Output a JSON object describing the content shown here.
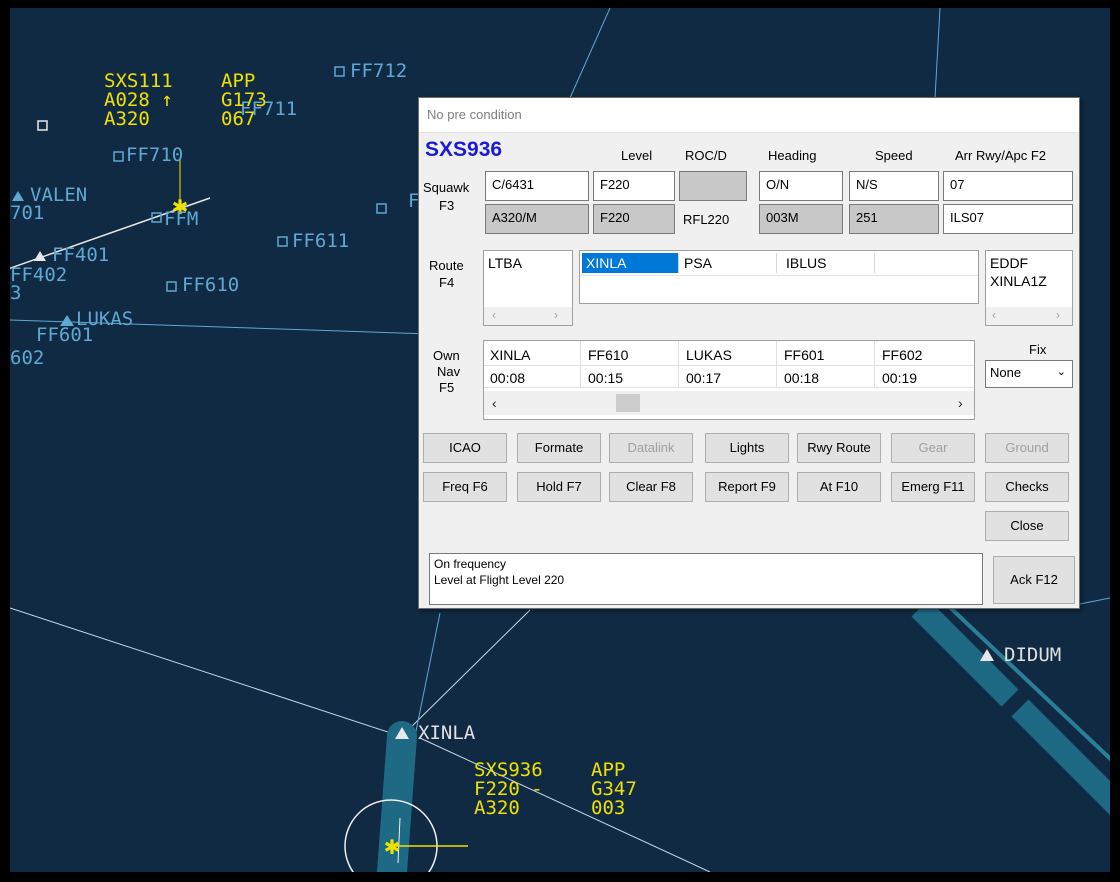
{
  "radar": {
    "fixes": [
      "FF712",
      "FF711",
      "FF710",
      "FFM",
      "FF611",
      "FF610",
      "FF401",
      "FF402",
      "FF601",
      "LUKAS",
      "VALEN",
      "XINLA",
      "DIDUM",
      "701",
      "602",
      "F",
      "3"
    ],
    "tags": [
      {
        "callsign": "SXS111",
        "stage": "APP",
        "level": "A028 ↑",
        "ground": "G173",
        "type": "A320",
        "speed": "067"
      },
      {
        "callsign": "SXS936",
        "stage": "APP",
        "level": "F220 -",
        "ground": "G347",
        "type": "A320",
        "speed": "003"
      }
    ],
    "colors": {
      "background": "#0f2a42",
      "fix": "#5fa8d3",
      "tag": "#f0e000",
      "route": "#1e6a84"
    }
  },
  "dialog": {
    "title": "No pre condition",
    "callsign": "SXS936",
    "headers": {
      "level": "Level",
      "rocd": "ROC/D",
      "heading": "Heading",
      "speed": "Speed",
      "arr": "Arr Rwy/Apc F2"
    },
    "squawk_label": "Squawk",
    "f3_label": "F3",
    "row1": {
      "squawk": "C/6431",
      "level": "F220",
      "rocd": "",
      "heading": "O/N",
      "speed": "N/S",
      "arr": "07"
    },
    "row2": {
      "type": "A320/M",
      "level": "F220",
      "rfl": "RFL220",
      "heading": "003M",
      "speed": "251",
      "app": "ILS07"
    },
    "route_label": "Route",
    "f4_label": "F4",
    "origin": "LTBA",
    "route_points": [
      "XINLA",
      "PSA",
      "IBLUS"
    ],
    "dest": {
      "airport": "EDDF",
      "star": "XINLA1Z"
    },
    "own_label": "Own",
    "nav_label": "Nav",
    "f5_label": "F5",
    "nav_points": [
      {
        "fix": "XINLA",
        "time": "00:08"
      },
      {
        "fix": "FF610",
        "time": "00:15"
      },
      {
        "fix": "LUKAS",
        "time": "00:17"
      },
      {
        "fix": "FF601",
        "time": "00:18"
      },
      {
        "fix": "FF602",
        "time": "00:19"
      }
    ],
    "fix_label": "Fix",
    "fix_value": "None",
    "buttons_row1": [
      "ICAO",
      "Formate",
      "Datalink",
      "Lights",
      "Rwy Route",
      "Gear",
      "Ground"
    ],
    "buttons_row2": [
      "Freq F6",
      "Hold F7",
      "Clear F8",
      "Report F9",
      "At F10",
      "Emerg F11",
      "Checks"
    ],
    "close": "Close",
    "messages": [
      "On frequency",
      "Level at Flight Level 220"
    ],
    "ack": "Ack F12"
  }
}
